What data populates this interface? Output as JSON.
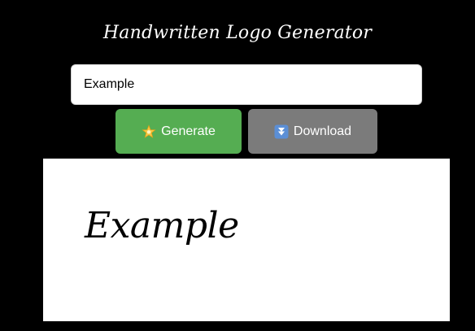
{
  "header": {
    "title": "Handwritten Logo Generator"
  },
  "form": {
    "input_value": "Example"
  },
  "buttons": {
    "generate_label": "Generate",
    "generate_icon": "glowing-star-icon",
    "download_label": "Download",
    "download_icon": "down-arrow-box-icon"
  },
  "canvas": {
    "text": "Example"
  },
  "colors": {
    "background": "#000000",
    "generate_button": "#55ad52",
    "download_button": "#7b7b7b",
    "canvas": "#ffffff",
    "download_icon_box": "#5b8fd6"
  }
}
